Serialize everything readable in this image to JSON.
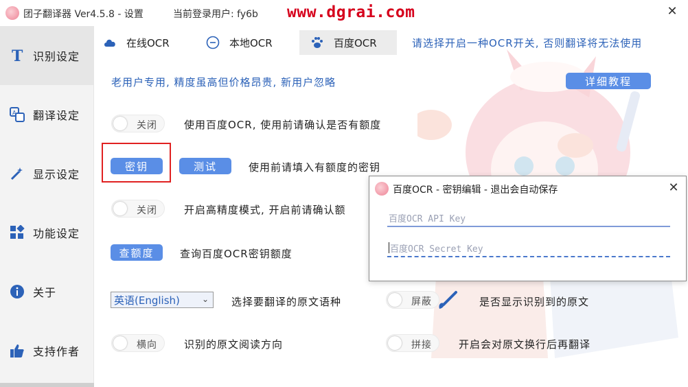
{
  "titlebar": {
    "app_title": "团子翻译器 Ver4.5.8 - 设置",
    "login_user": "当前登录用户: fy6b",
    "watermark": "www.dgrai.com",
    "close_glyph": "✕"
  },
  "sidebar": {
    "items": [
      {
        "label": "识别设定",
        "icon": "text-t-icon",
        "active": true
      },
      {
        "label": "翻译设定",
        "icon": "translate-icon",
        "active": false
      },
      {
        "label": "显示设定",
        "icon": "magic-wand-icon",
        "active": false
      },
      {
        "label": "功能设定",
        "icon": "widgets-icon",
        "active": false
      },
      {
        "label": "关于",
        "icon": "info-icon",
        "active": false
      },
      {
        "label": "支持作者",
        "icon": "thumbs-up-icon",
        "active": false
      }
    ]
  },
  "tabs": {
    "items": [
      {
        "label": "在线OCR",
        "icon": "cloud-icon",
        "active": false
      },
      {
        "label": "本地OCR",
        "icon": "minus-circle-icon",
        "active": false
      },
      {
        "label": "百度OCR",
        "icon": "paw-icon",
        "active": true
      }
    ],
    "hint": "请选择开启一种OCR开关, 否则翻译将无法使用"
  },
  "content": {
    "notice": "老用户专用, 精度虽高但价格昂贵, 新用户忽略",
    "tutorial_button": "详细教程",
    "baidu_toggle": {
      "label": "关闭",
      "on": false
    },
    "baidu_desc": "使用百度OCR, 使用前请确认是否有额度",
    "key_button": "密钥",
    "test_button": "测试",
    "key_desc": "使用前请填入有额度的密钥",
    "hiprec_toggle": {
      "label": "关闭",
      "on": false
    },
    "hiprec_desc": "开启高精度模式, 开启前请确认额",
    "quota_button": "查额度",
    "quota_desc": "查询百度OCR密钥额度",
    "language_select": {
      "value": "英语(English)",
      "caret": "⌄"
    },
    "language_desc": "选择要翻译的原文语种",
    "show_toggle": {
      "label": "屏蔽",
      "on": false
    },
    "show_desc": "是否显示识别到的原文",
    "direction_toggle": {
      "label": "横向",
      "on": false
    },
    "direction_desc": "识别的原文阅读方向",
    "join_toggle": {
      "label": "拼接",
      "on": false
    },
    "join_desc": "开启会对原文换行后再翻译"
  },
  "dialog": {
    "title": "百度OCR - 密钥编辑 - 退出会自动保存",
    "close_glyph": "✕",
    "api_key": {
      "value": "",
      "placeholder": "百度OCR API Key"
    },
    "secret_key": {
      "value": "",
      "placeholder": "百度OCR Secret Key"
    }
  },
  "colors": {
    "accent": "#2c62b8",
    "button": "#5a8ee6",
    "highlight_box": "#e02020",
    "watermark": "#d6001c"
  }
}
